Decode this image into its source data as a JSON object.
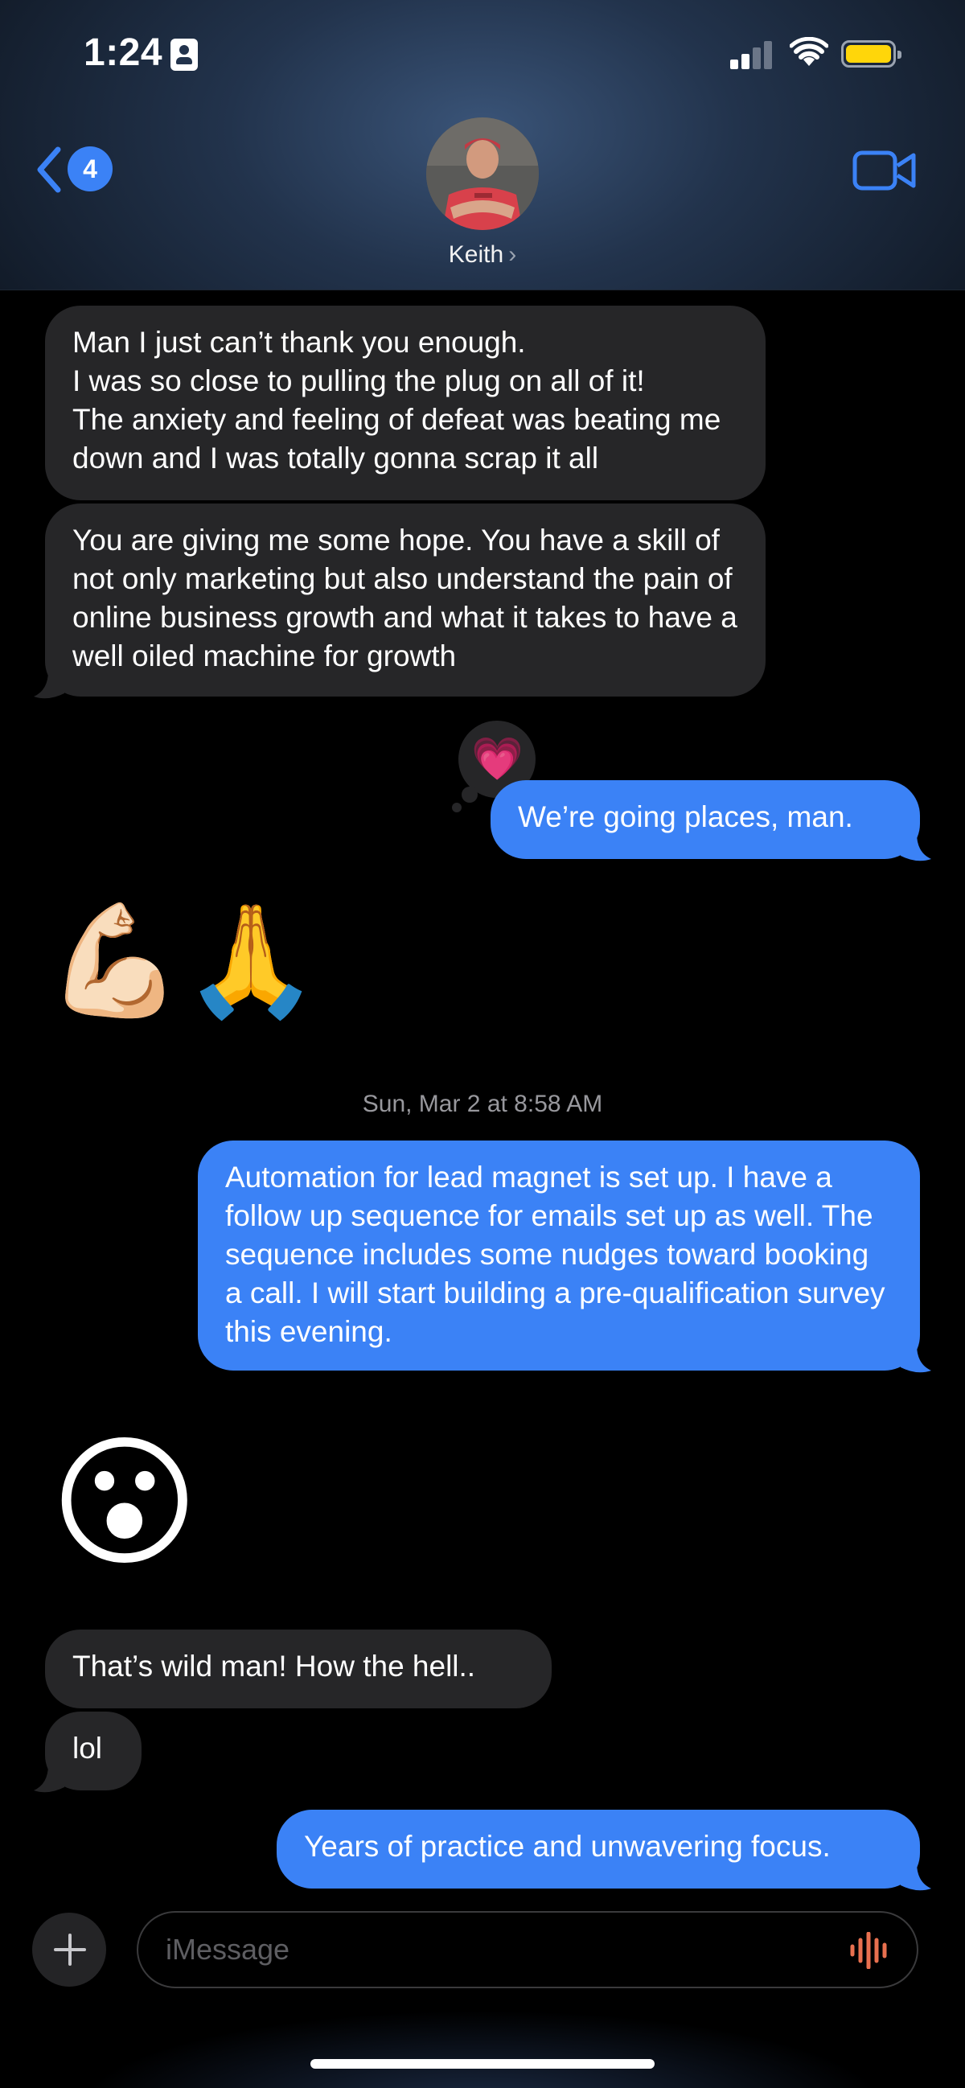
{
  "status_bar": {
    "time": "1:24"
  },
  "header": {
    "back_count": "4",
    "contact_name": "Keith",
    "contact_chevron": "›"
  },
  "messages": [
    {
      "direction": "incoming",
      "text": "Man I just can’t thank you enough.\nI was so close to pulling the plug on all of it!\nThe anxiety and feeling of defeat was beating me down and I was totally gonna scrap it all"
    },
    {
      "direction": "incoming",
      "text": "You are giving me some hope. You have a skill of not only marketing but also understand the pain of online business growth and what it takes to have a well oiled machine for growth"
    },
    {
      "direction": "outgoing",
      "text": "We’re going places, man.",
      "reaction": "💗"
    },
    {
      "direction": "incoming",
      "text": "💪🏻🙏",
      "type": "emoji"
    },
    {
      "direction": "outgoing",
      "text": "Automation for lead magnet is set up. I have a follow up sequence for emails set up as well. The sequence includes some nudges toward booking a call. I will start building a pre-qualification survey this evening."
    },
    {
      "direction": "incoming",
      "text": "😮",
      "type": "emoji"
    },
    {
      "direction": "incoming",
      "text": "That’s wild man! How the hell.."
    },
    {
      "direction": "incoming",
      "text": "lol"
    },
    {
      "direction": "outgoing",
      "text": "Years of practice and unwavering focus."
    }
  ],
  "timestamp": "Sun, Mar 2 at 8:58 AM",
  "composer": {
    "placeholder": "iMessage"
  },
  "icons": {
    "back": "chevron-left-icon",
    "video": "video-camera-icon",
    "plus": "plus-icon",
    "audio": "waveform-icon",
    "status": [
      "id-card-icon",
      "cellular-signal-icon",
      "wifi-icon",
      "battery-icon"
    ]
  },
  "colors": {
    "accent": "#3b82f6",
    "incoming_bubble": "#262628",
    "outgoing_bubble": "#3b82f6",
    "battery": "#ffd60a",
    "audio_icon": "#e8704f",
    "background": "#000000"
  }
}
